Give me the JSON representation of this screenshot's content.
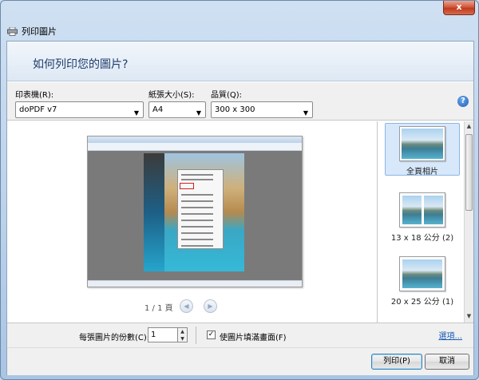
{
  "window": {
    "title": "列印圖片",
    "close_label": "x"
  },
  "header": {
    "title": "如何列印您的圖片?"
  },
  "options": {
    "printer_label": "印表機(R):",
    "printer_value": "doPDF v7",
    "paper_label": "紙張大小(S):",
    "paper_value": "A4",
    "quality_label": "品質(Q):",
    "quality_value": "300 x 300",
    "help_label": "?"
  },
  "preview": {
    "page_indicator": "1 / 1 頁",
    "prev_icon": "◀",
    "next_icon": "▶"
  },
  "layouts": [
    {
      "label": "全頁相片",
      "selected": true
    },
    {
      "label": "13 x 18 公分 (2)",
      "selected": false
    },
    {
      "label": "20 x 25 公分 (1)",
      "selected": false
    }
  ],
  "bottom": {
    "copies_label": "每張圖片的份數(C):",
    "copies_value": "1",
    "fit_label": "使圖片填滿畫面(F)",
    "fit_checked": true,
    "options_link": "選項..."
  },
  "footer": {
    "print_label": "列印(P)",
    "cancel_label": "取消"
  },
  "icons": {
    "printer": "printer-icon",
    "help": "help-icon",
    "check": "✓",
    "arrow": "▼",
    "up": "▲",
    "down": "▼"
  },
  "colors": {
    "header_text": "#1e3d6b",
    "link": "#1a5bb5",
    "selected_bg": "#d7e8fb",
    "close": "#c13a1c"
  }
}
